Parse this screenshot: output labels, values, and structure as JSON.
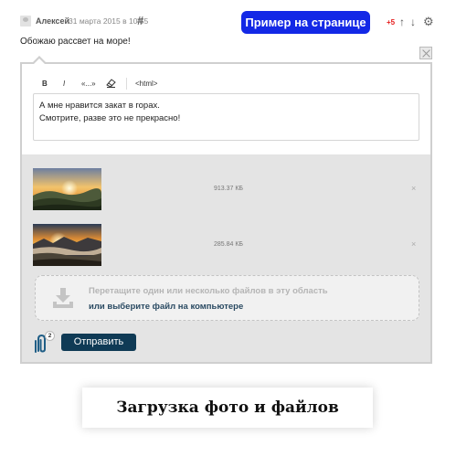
{
  "comment": {
    "author": "Алексей",
    "date": "31 марта 2015 в 10:55",
    "permalink_symbol": "#",
    "rating": "+5",
    "vote_up_symbol": "↑",
    "vote_down_symbol": "↓",
    "settings_symbol": "⚙",
    "text": "Обожаю рассвет на море!"
  },
  "example_button": {
    "label": "Пример на странице",
    "color": "#1328e6"
  },
  "editor": {
    "toolbar": {
      "bold": "B",
      "italic": "I",
      "quote": "«...»",
      "html": "<html>"
    },
    "textarea_lines": [
      "А мне нравится закат в горах.",
      "Смотрите, разве это не прекрасно!"
    ],
    "files": [
      {
        "size": "913.37 КБ",
        "remove": "×",
        "thumbnail": "sunrise-over-hills"
      },
      {
        "size": "285.84 КБ",
        "remove": "×",
        "thumbnail": "sunset-over-valley"
      }
    ],
    "dropzone": {
      "line1": "Перетащите один или несколько файлов в эту область",
      "line2": "или выберите файл на компьютере"
    },
    "attachments_count": "2",
    "send_label": "Отправить",
    "send_color": "#0f3a55"
  },
  "caption": "Загрузка фото и файлов"
}
